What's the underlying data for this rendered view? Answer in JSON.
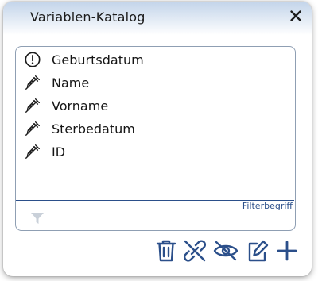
{
  "dialog": {
    "title": "Variablen-Katalog",
    "close_icon": "close-icon"
  },
  "list": {
    "items": [
      {
        "label": "Geburtsdatum",
        "icon": "exclamation-circle-icon"
      },
      {
        "label": "Name",
        "icon": "syringe-icon"
      },
      {
        "label": "Vorname",
        "icon": "syringe-icon"
      },
      {
        "label": "Sterbedatum",
        "icon": "syringe-icon"
      },
      {
        "label": "ID",
        "icon": "syringe-icon"
      }
    ]
  },
  "filter": {
    "label": "Filterbegriff",
    "value": "",
    "icon": "funnel-icon"
  },
  "toolbar": {
    "buttons": [
      {
        "icon": "trash-icon"
      },
      {
        "icon": "unlink-icon"
      },
      {
        "icon": "eye-slash-icon"
      },
      {
        "icon": "edit-icon"
      },
      {
        "icon": "plus-icon"
      }
    ]
  },
  "colors": {
    "accent": "#2b4f8a",
    "title_gradient_top": "#c3d4ea",
    "filter_icon": "#c9d0d9"
  }
}
